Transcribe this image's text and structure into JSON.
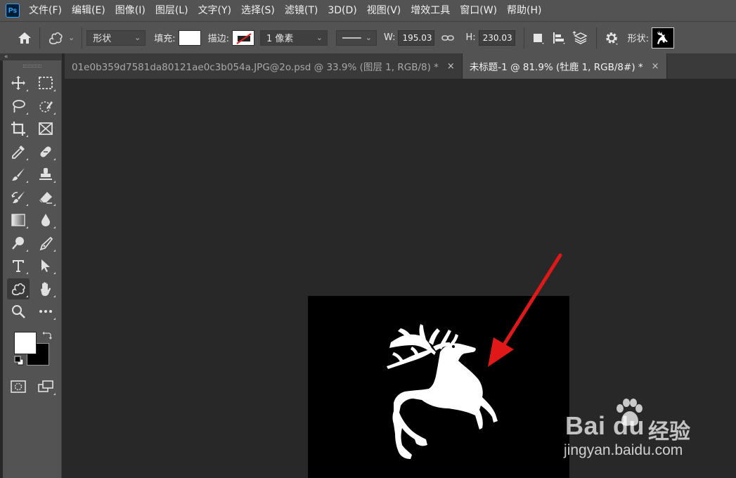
{
  "app": {
    "logo_text": "Ps"
  },
  "menu": {
    "items": [
      "文件(F)",
      "编辑(E)",
      "图像(I)",
      "图层(L)",
      "文字(Y)",
      "选择(S)",
      "滤镜(T)",
      "3D(D)",
      "视图(V)",
      "增效工具",
      "窗口(W)",
      "帮助(H)"
    ]
  },
  "options": {
    "mode_value": "形状",
    "fill_label": "填充:",
    "fill_color": "#ffffff",
    "stroke_label": "描边:",
    "stroke_width_value": "1 像素",
    "width_label": "W:",
    "width_value": "195.03",
    "height_label": "H:",
    "height_value": "230.03",
    "shape_label": "形状:"
  },
  "toolbar": {
    "collapse_glyph": "«",
    "active_tool": "custom-shape-tool",
    "foreground_color": "#ffffff",
    "background_color": "#000000"
  },
  "tabs": [
    {
      "label": "01e0b359d7581da80121ae0c3b054a.JPG@2o.psd @ 33.9% (图层 1, RGB/8) *",
      "active": false,
      "close": "×"
    },
    {
      "label": "未标题-1 @ 81.9% (牡鹿 1, RGB/8#) *",
      "active": true,
      "close": "×"
    }
  ],
  "canvas": {
    "background": "#000000",
    "shape_color": "#ffffff",
    "shape_name": "stag-shape",
    "annotation_arrow_color": "#e01818"
  },
  "watermark": {
    "brand": "Bai du",
    "brand_cn": "经验",
    "url": "jingyan.baidu.com"
  }
}
